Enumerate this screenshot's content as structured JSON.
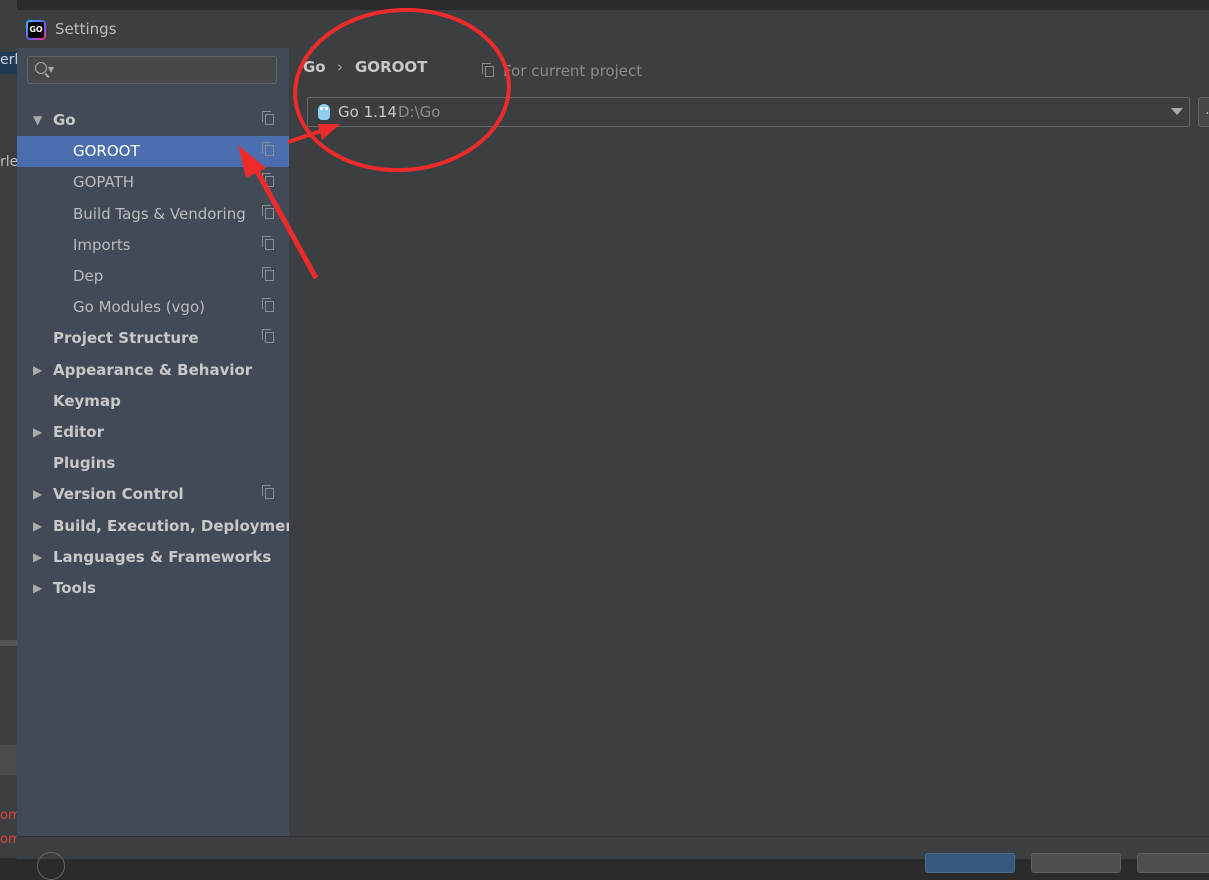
{
  "window": {
    "title": "Settings",
    "logo_text": "GO"
  },
  "background": {
    "text1": "erl",
    "text2": "rle",
    "err1": "om",
    "err2": "om"
  },
  "sidebar": {
    "search_placeholder": "",
    "items": [
      {
        "label": "Go",
        "expanded": true,
        "has_project_icon": true
      },
      {
        "label": "GOROOT",
        "selected": true,
        "has_project_icon": true
      },
      {
        "label": "GOPATH",
        "has_project_icon": true
      },
      {
        "label": "Build Tags & Vendoring",
        "has_project_icon": true
      },
      {
        "label": "Imports",
        "has_project_icon": true
      },
      {
        "label": "Dep",
        "has_project_icon": true
      },
      {
        "label": "Go Modules (vgo)",
        "has_project_icon": true
      },
      {
        "label": "Project Structure",
        "has_project_icon": true
      },
      {
        "label": "Appearance & Behavior",
        "collapsed": true
      },
      {
        "label": "Keymap"
      },
      {
        "label": "Editor",
        "collapsed": true
      },
      {
        "label": "Plugins"
      },
      {
        "label": "Version Control",
        "collapsed": true,
        "has_project_icon": true
      },
      {
        "label": "Build, Execution, Deployment",
        "collapsed": true
      },
      {
        "label": "Languages & Frameworks",
        "collapsed": true
      },
      {
        "label": "Tools",
        "collapsed": true
      }
    ]
  },
  "main": {
    "breadcrumb": [
      "Go",
      "GOROOT"
    ],
    "breadcrumb_sep": "›",
    "scope_text": "For current project",
    "sdk": {
      "name": "Go 1.14",
      "path": "D:\\Go"
    },
    "more_button": "…"
  },
  "icons": {
    "expanded_arrow": "▼",
    "collapsed_arrow": "▶",
    "project": "project-scope-icon",
    "gopher": "gopher-icon"
  },
  "colors": {
    "selection": "#4b6eaf",
    "sidebar_bg": "#434a57",
    "panel_bg": "#3c3f41",
    "annotation": "#ee2b2b"
  }
}
